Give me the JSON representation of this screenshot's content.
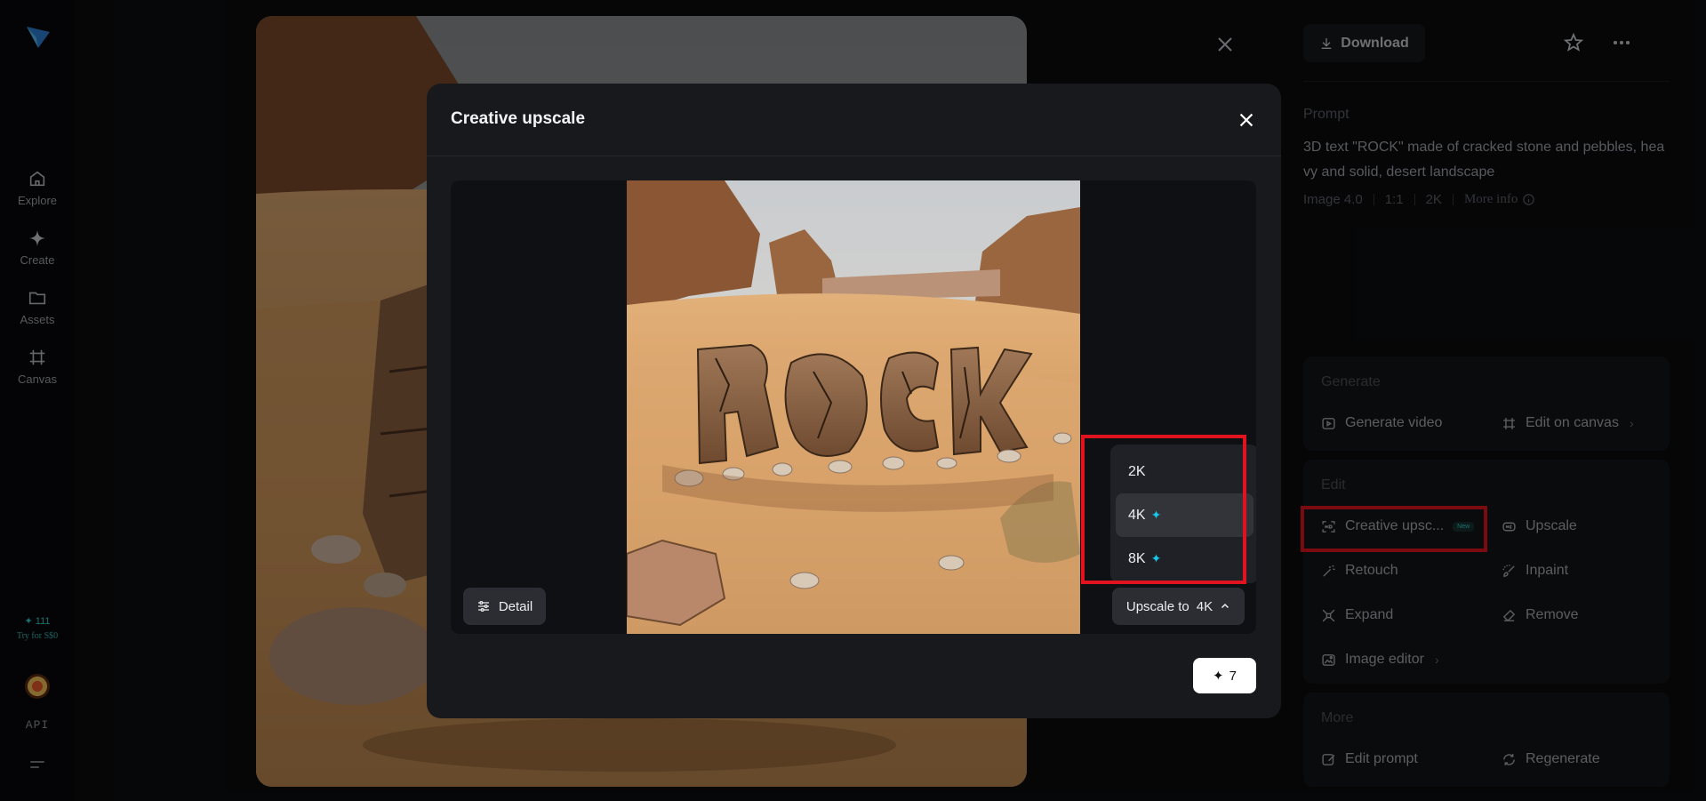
{
  "nav": {
    "items": [
      {
        "label": "Explore",
        "icon": "home-icon"
      },
      {
        "label": "Create",
        "icon": "sparkle-icon"
      },
      {
        "label": "Assets",
        "icon": "folder-icon"
      },
      {
        "label": "Canvas",
        "icon": "canvas-icon"
      }
    ],
    "credits": "111",
    "credits_icon": "✦",
    "try_label": "Try for S$0",
    "api_label": "API"
  },
  "panel": {
    "download_label": "Download",
    "prompt_label": "Prompt",
    "prompt_text": "3D text \"ROCK\" made of cracked stone and pebbles, heavy and solid, desert landscape",
    "meta": {
      "model": "Image 4.0",
      "ratio": "1:1",
      "resolution": "2K",
      "more_info": "More info"
    },
    "generate": {
      "title": "Generate",
      "video": "Generate video",
      "canvas": "Edit on canvas"
    },
    "edit": {
      "title": "Edit",
      "creative_upscale": "Creative upsc...",
      "new_badge": "New",
      "upscale": "Upscale",
      "retouch": "Retouch",
      "inpaint": "Inpaint",
      "expand": "Expand",
      "remove": "Remove",
      "image_editor": "Image editor"
    },
    "more": {
      "title": "More",
      "edit_prompt": "Edit prompt",
      "regenerate": "Regenerate"
    }
  },
  "modal": {
    "title": "Creative upscale",
    "detail_label": "Detail",
    "upscale_prefix": "Upscale to",
    "upscale_value": "4K",
    "options": [
      {
        "label": "2K",
        "premium": false
      },
      {
        "label": "4K",
        "premium": true
      },
      {
        "label": "8K",
        "premium": true
      }
    ],
    "selected_option": "4K",
    "spark_glyph": "✦",
    "cost": "7",
    "cost_icon": "✦"
  },
  "colors": {
    "accent": "#18c6e8",
    "highlight": "#e0131f",
    "credit": "#2fd0c8"
  }
}
